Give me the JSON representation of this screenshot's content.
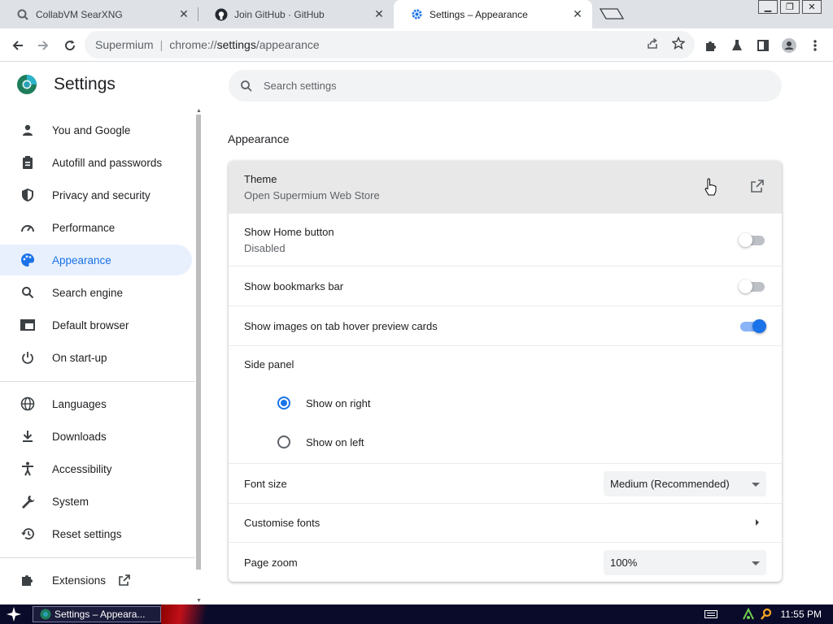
{
  "tabs": [
    {
      "title": "CollabVM SearXNG",
      "active": false
    },
    {
      "title": "Join GitHub · GitHub",
      "active": false
    },
    {
      "title": "Settings – Appearance",
      "active": true
    }
  ],
  "omnibox": {
    "site": "Supermium",
    "scheme": "chrome://",
    "host": "settings",
    "path": "/appearance"
  },
  "settings": {
    "app_title": "Settings",
    "search_placeholder": "Search settings",
    "sidebar": [
      {
        "label": "You and Google",
        "icon": "person-icon"
      },
      {
        "label": "Autofill and passwords",
        "icon": "clipboard-icon"
      },
      {
        "label": "Privacy and security",
        "icon": "shield-icon"
      },
      {
        "label": "Performance",
        "icon": "speedometer-icon"
      },
      {
        "label": "Appearance",
        "icon": "palette-icon",
        "active": true
      },
      {
        "label": "Search engine",
        "icon": "search-icon"
      },
      {
        "label": "Default browser",
        "icon": "browser-window-icon"
      },
      {
        "label": "On start-up",
        "icon": "power-icon"
      },
      {
        "label": "Languages",
        "icon": "globe-icon"
      },
      {
        "label": "Downloads",
        "icon": "download-icon"
      },
      {
        "label": "Accessibility",
        "icon": "accessibility-icon"
      },
      {
        "label": "System",
        "icon": "wrench-icon"
      },
      {
        "label": "Reset settings",
        "icon": "reset-history-icon"
      },
      {
        "label": "Extensions",
        "icon": "puzzle-icon"
      }
    ],
    "section_title": "Appearance",
    "theme": {
      "label": "Theme",
      "sublabel": "Open Supermium Web Store"
    },
    "home_button": {
      "label": "Show Home button",
      "sublabel": "Disabled",
      "enabled": false
    },
    "bookmarks_bar": {
      "label": "Show bookmarks bar",
      "enabled": false
    },
    "hover_cards": {
      "label": "Show images on tab hover preview cards",
      "enabled": true
    },
    "side_panel": {
      "label": "Side panel",
      "options": [
        "Show on right",
        "Show on left"
      ],
      "selected": "Show on right"
    },
    "font_size": {
      "label": "Font size",
      "value": "Medium (Recommended)"
    },
    "customise_fonts": {
      "label": "Customise fonts"
    },
    "page_zoom": {
      "label": "Page zoom",
      "value": "100%"
    }
  },
  "colors": {
    "accent": "#1a73e8",
    "active_bg": "#e8f0fe",
    "tabstrip": "#dee1e6",
    "taskbar": "#0a0a2a"
  },
  "taskbar": {
    "window_title": "Settings – Appeara...",
    "time": "11:55 PM"
  }
}
